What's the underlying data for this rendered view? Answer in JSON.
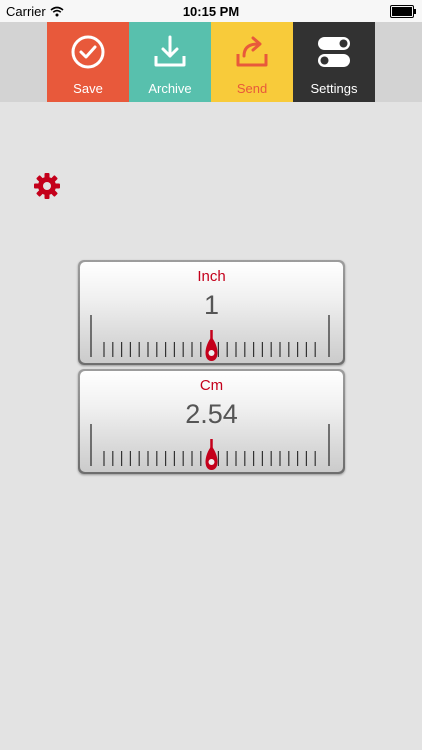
{
  "status_bar": {
    "carrier": "Carrier",
    "time": "10:15 PM"
  },
  "toolbar": {
    "items": [
      {
        "label": "Save",
        "color": "#e8593b",
        "icon": "checkmark-circle-icon"
      },
      {
        "label": "Archive",
        "color": "#58c0ad",
        "icon": "download-tray-icon"
      },
      {
        "label": "Send",
        "color": "#f8cb3a",
        "icon": "share-arrow-icon"
      },
      {
        "label": "Settings",
        "color": "#323232",
        "icon": "toggle-switches-icon"
      }
    ]
  },
  "gauges": [
    {
      "unit": "Inch",
      "value": "1"
    },
    {
      "unit": "Cm",
      "value": "2.54"
    }
  ],
  "colors": {
    "accent_red": "#c4001b",
    "background": "#e3e3e3"
  }
}
